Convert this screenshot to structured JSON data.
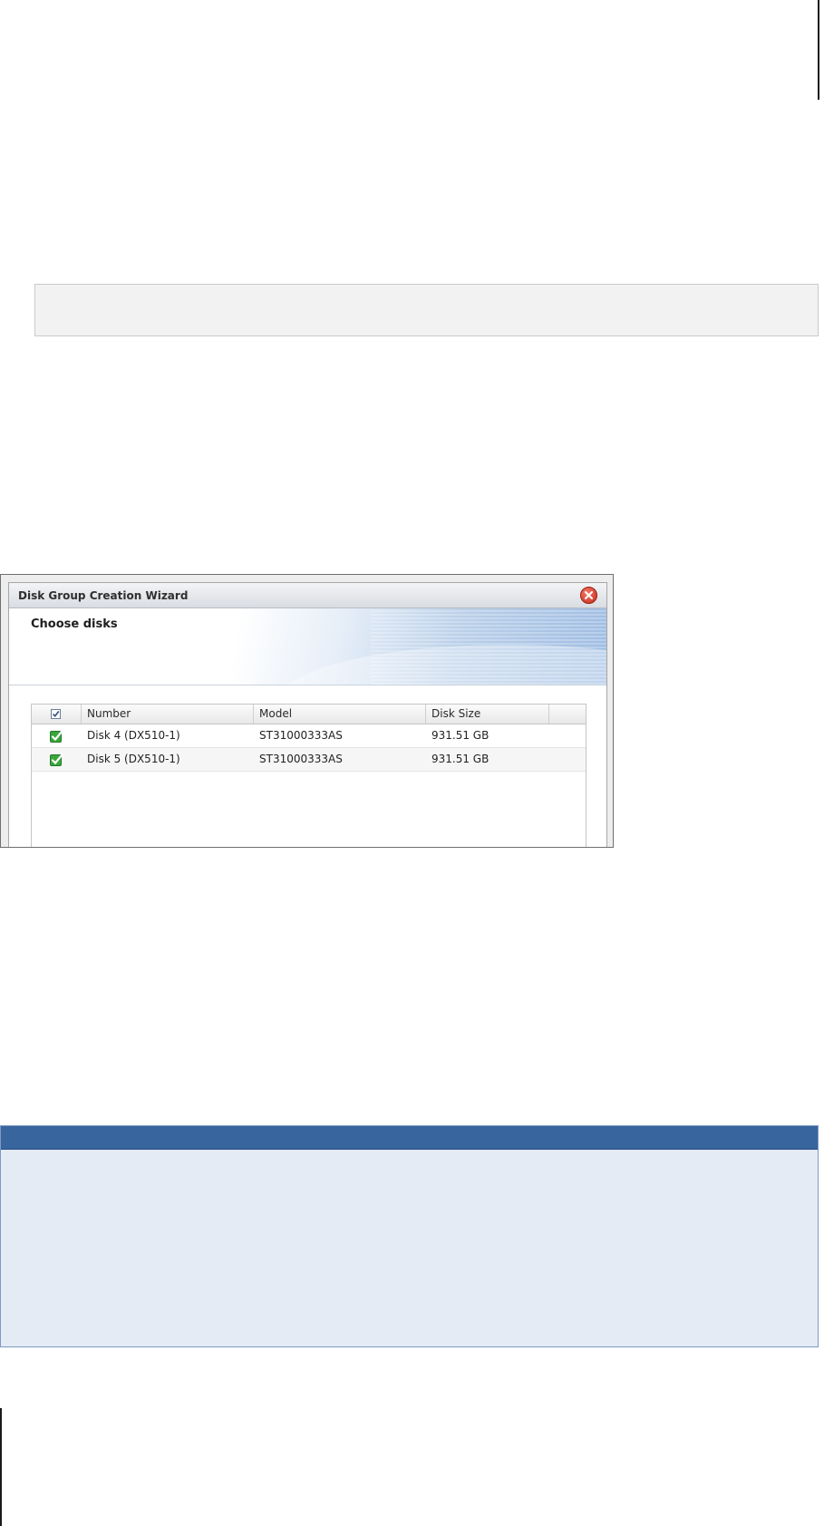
{
  "wizard": {
    "title": "Disk Group Creation Wizard",
    "step_title": "Choose disks",
    "columns": [
      "Number",
      "Model",
      "Disk Size"
    ],
    "rows": [
      {
        "number": "Disk 4 (DX510-1)",
        "model": "ST31000333AS",
        "size": "931.51 GB",
        "checked": true
      },
      {
        "number": "Disk 5 (DX510-1)",
        "model": "ST31000333AS",
        "size": "931.51 GB",
        "checked": true
      }
    ]
  },
  "icons": {
    "close": "close-icon",
    "select_all": "checkbox-icon",
    "row_check": "green-check-icon"
  },
  "colors": {
    "note_bar": "#39659e",
    "note_background": "#e4ebf5",
    "close_button": "#c7281a",
    "check_green": "#3aa63a"
  }
}
